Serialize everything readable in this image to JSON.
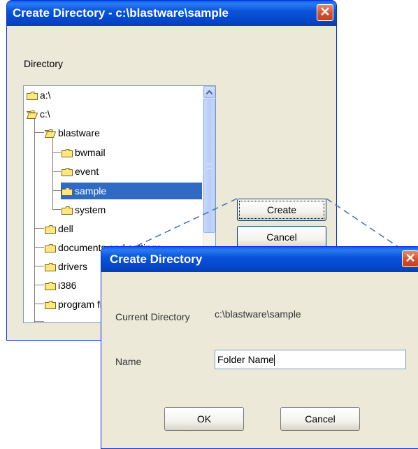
{
  "main_dialog": {
    "title": "Create Directory - c:\\blastware\\sample",
    "directory_label": "Directory",
    "tree": [
      {
        "label": "a:\\",
        "open": false
      },
      {
        "label": "c:\\",
        "open": true
      },
      {
        "label": "blastware",
        "open": true
      },
      {
        "label": "bwmail",
        "open": false
      },
      {
        "label": "event",
        "open": false
      },
      {
        "label": "sample",
        "open": false,
        "selected": true
      },
      {
        "label": "system",
        "open": false
      },
      {
        "label": "dell",
        "open": false
      },
      {
        "label": "documents and settings",
        "open": false
      },
      {
        "label": "drivers",
        "open": false
      },
      {
        "label": "i386",
        "open": false
      },
      {
        "label": "program files",
        "open": false
      }
    ],
    "create_label": "Create",
    "cancel_label": "Cancel",
    "close_glyph": "✕"
  },
  "sub_dialog": {
    "title": "Create Directory",
    "current_directory_label": "Current Directory",
    "current_directory_value": "c:\\blastware\\sample",
    "name_label": "Name",
    "name_value": "Folder Name",
    "ok_label": "OK",
    "cancel_label": "Cancel",
    "close_glyph": "✕"
  },
  "colors": {
    "titlebar": "#0a54dc",
    "selection": "#316ac5",
    "dialog_bg": "#ece9d8",
    "folder_fill": "#ffe680"
  },
  "icons": [
    "folder-icon",
    "open-folder-icon",
    "close-icon",
    "scroll-up-icon"
  ]
}
